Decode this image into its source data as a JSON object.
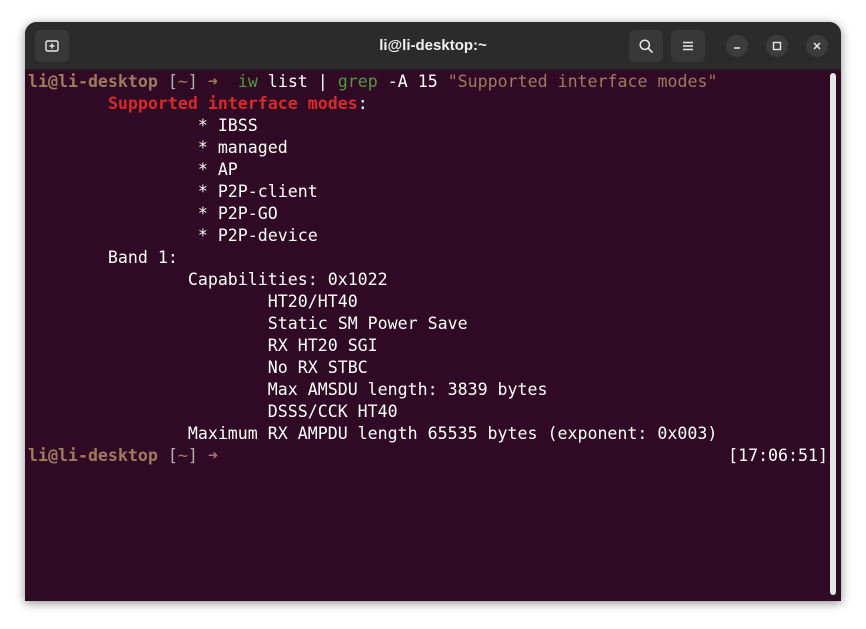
{
  "window": {
    "title": "li@li-desktop:~"
  },
  "titlebar": {
    "new_tab_icon": "new-tab-icon",
    "search_icon": "search-icon",
    "menu_icon": "hamburger-menu-icon",
    "minimize_icon": "minimize-icon",
    "maximize_icon": "maximize-icon",
    "close_icon": "close-icon"
  },
  "terminal": {
    "prompt": {
      "user_host": "li@li-desktop",
      "dir_open": "[",
      "dir": "~",
      "dir_close": "]",
      "arrow": "➜"
    },
    "command": {
      "prog": "iw",
      "arg1": " list ",
      "pipe": "| ",
      "grep": "grep",
      "flag": " -A 15 ",
      "pattern": "\"Supported interface modes\""
    },
    "output": [
      {
        "indent": "        ",
        "match": "Supported interface modes",
        "rest": ":"
      },
      {
        "indent": "",
        "match": "",
        "rest": "                 * IBSS"
      },
      {
        "indent": "",
        "match": "",
        "rest": "                 * managed"
      },
      {
        "indent": "",
        "match": "",
        "rest": "                 * AP"
      },
      {
        "indent": "",
        "match": "",
        "rest": "                 * P2P-client"
      },
      {
        "indent": "",
        "match": "",
        "rest": "                 * P2P-GO"
      },
      {
        "indent": "",
        "match": "",
        "rest": "                 * P2P-device"
      },
      {
        "indent": "",
        "match": "",
        "rest": "        Band 1:"
      },
      {
        "indent": "",
        "match": "",
        "rest": "                Capabilities: 0x1022"
      },
      {
        "indent": "",
        "match": "",
        "rest": "                        HT20/HT40"
      },
      {
        "indent": "",
        "match": "",
        "rest": "                        Static SM Power Save"
      },
      {
        "indent": "",
        "match": "",
        "rest": "                        RX HT20 SGI"
      },
      {
        "indent": "",
        "match": "",
        "rest": "                        No RX STBC"
      },
      {
        "indent": "",
        "match": "",
        "rest": "                        Max AMSDU length: 3839 bytes"
      },
      {
        "indent": "",
        "match": "",
        "rest": "                        DSSS/CCK HT40"
      },
      {
        "indent": "",
        "match": "",
        "rest": "                Maximum RX AMPDU length 65535 bytes (exponent: 0x003)"
      }
    ],
    "clock": "[17:06:51]"
  },
  "colors": {
    "background": "#300a24",
    "titlebar": "#2b2b2b",
    "prompt": "#9f7a5e",
    "command": "#4e9a3e",
    "match": "#d62a2a"
  }
}
